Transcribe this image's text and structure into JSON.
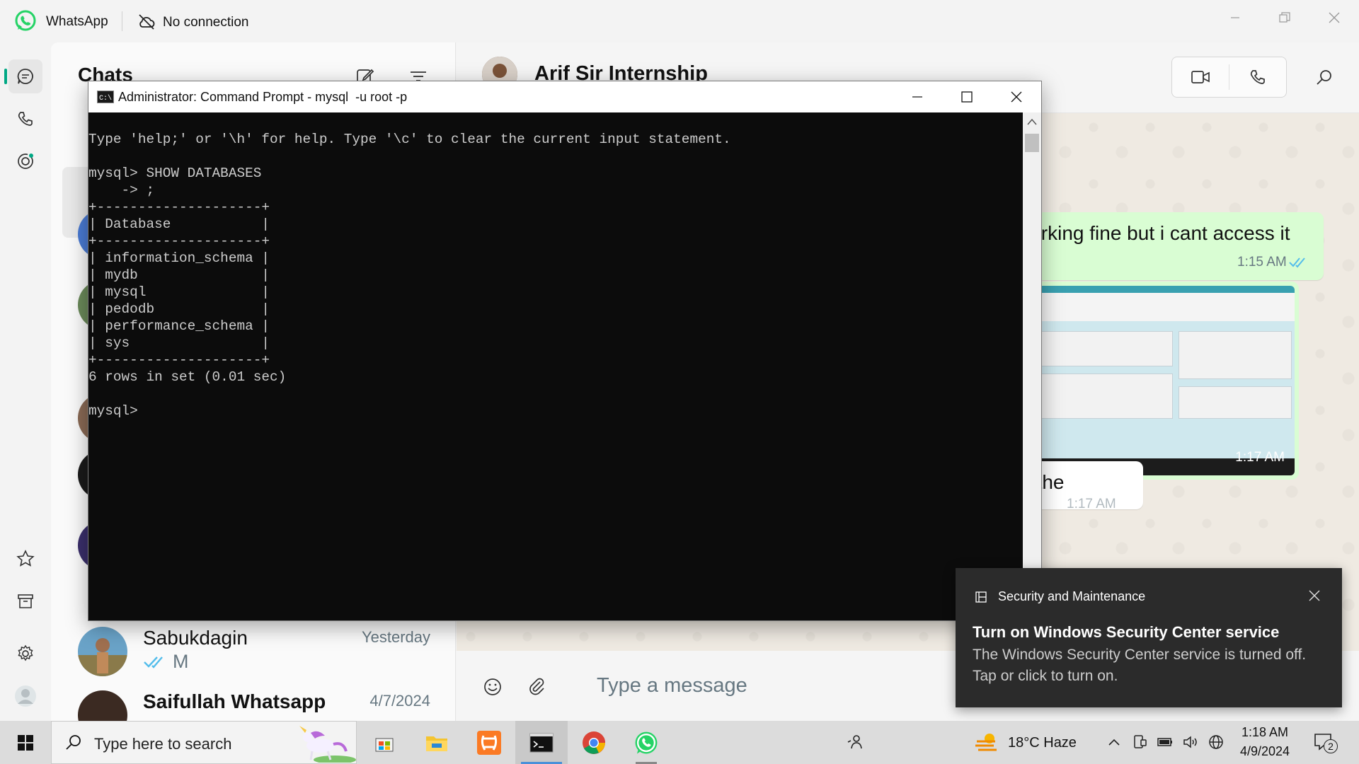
{
  "whatsapp": {
    "app_title": "WhatsApp",
    "connection_status": "No connection",
    "chat_list": {
      "title": "Chats",
      "chats": [
        {
          "name": "Sabukdagin",
          "time": "Yesterday",
          "preview": "M"
        },
        {
          "name": "Saifullah Whatsapp",
          "time": "4/7/2024",
          "preview": ""
        }
      ]
    },
    "conversation": {
      "contact_name": "Arif Sir Internship",
      "messages": [
        {
          "text": "working fine but i cant access it",
          "time": "1:15 AM"
        },
        {
          "text": "",
          "time": "1:17 AM",
          "type": "image"
        },
        {
          "text": "in the",
          "time": "1:17 AM"
        }
      ],
      "input_placeholder": "Type a message"
    }
  },
  "cmd": {
    "title": "Administrator: Command Prompt - mysql  -u root -p",
    "lines": [
      "Type 'help;' or '\\h' for help. Type '\\c' to clear the current input statement.",
      "",
      "mysql> SHOW DATABASES",
      "    -> ;",
      "+--------------------+",
      "| Database           |",
      "+--------------------+",
      "| information_schema |",
      "| mydb               |",
      "| mysql              |",
      "| pedodb             |",
      "| performance_schema |",
      "| sys                |",
      "+--------------------+",
      "6 rows in set (0.01 sec)",
      "",
      "mysql>"
    ]
  },
  "toast": {
    "app_name": "Security and Maintenance",
    "title": "Turn on Windows Security Center service",
    "body": "The Windows Security Center service is turned off. Tap or click to turn on."
  },
  "taskbar": {
    "search_placeholder": "Type here to search",
    "weather": "18°C  Haze",
    "time": "1:18 AM",
    "date": "4/9/2024",
    "notification_count": "2",
    "apps": [
      "microsoft-store",
      "file-explorer",
      "xampp",
      "command-prompt",
      "chrome",
      "whatsapp"
    ]
  },
  "colors": {
    "whatsapp_green": "#00a884",
    "bubble_out": "#d9fdd3",
    "terminal_bg": "#0c0c0c"
  }
}
